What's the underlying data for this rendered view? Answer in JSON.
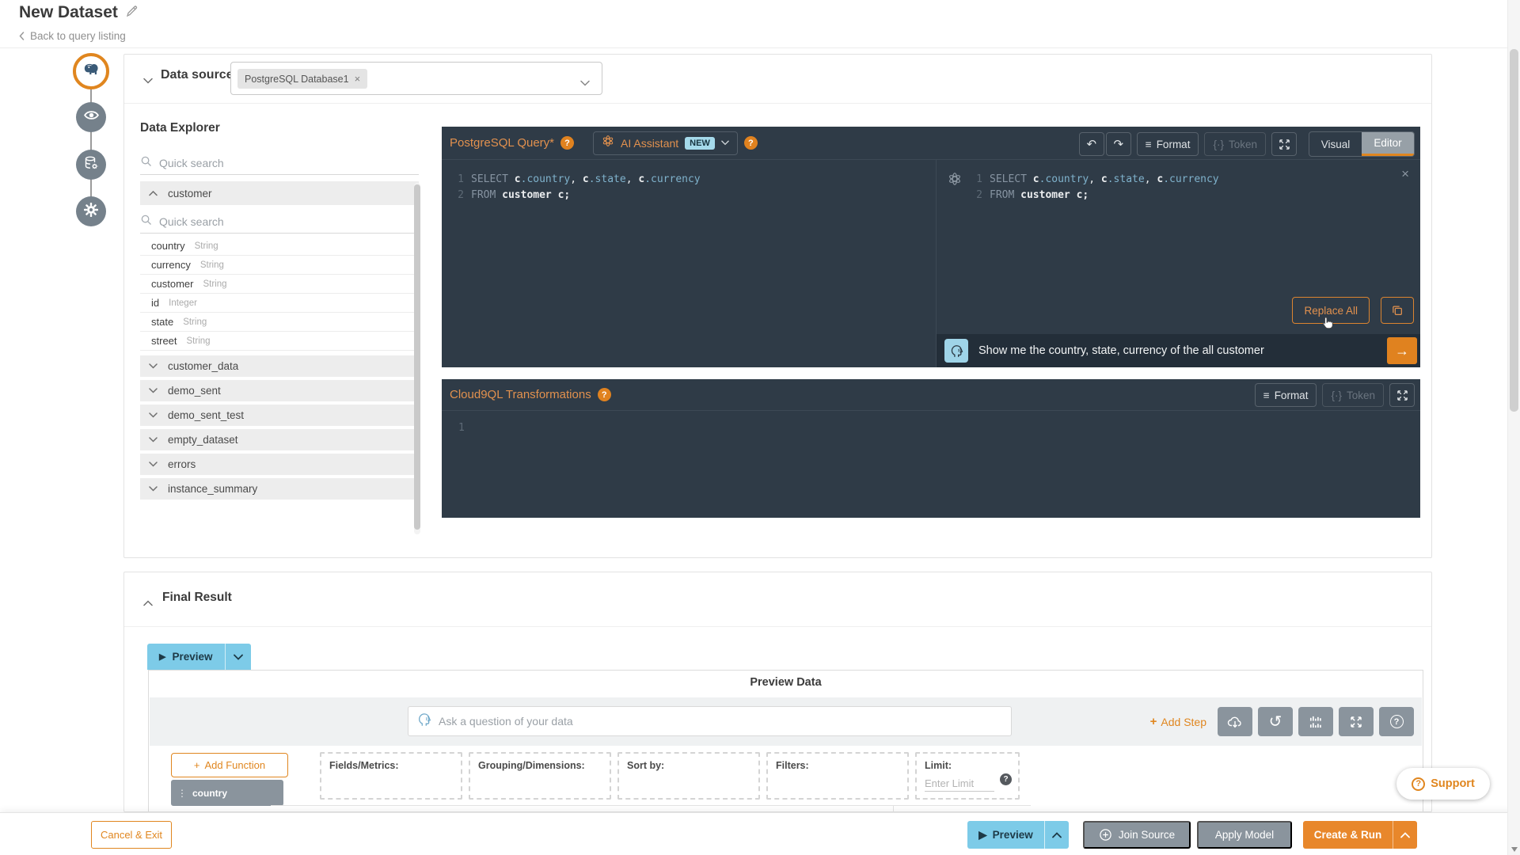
{
  "icons": {
    "play": "▶",
    "times": "×",
    "close": "×",
    "arrow_right": "→",
    "format_bars": "≡",
    "undo": "↶",
    "redo": "↷",
    "reset": "↺",
    "drag_dots": "⋮",
    "question": "?",
    "plus": "+",
    "token_braces": "{·}"
  },
  "colors": {
    "accent_orange": "#E0861F",
    "light_blue": "#7DCBE8",
    "panel_dark": "#2F3B47",
    "gray_button": "#8A949D"
  },
  "header": {
    "title": "New Dataset",
    "back_label": "Back to query listing"
  },
  "data_source": {
    "label": "Data source",
    "tag": "PostgreSQL Database1"
  },
  "explorer": {
    "title": "Data Explorer",
    "search_placeholder": "Quick search",
    "expanded_table": "customer",
    "field_search_placeholder": "Quick search",
    "fields": [
      {
        "name": "country",
        "type": "String"
      },
      {
        "name": "currency",
        "type": "String"
      },
      {
        "name": "customer",
        "type": "String"
      },
      {
        "name": "id",
        "type": "Integer"
      },
      {
        "name": "state",
        "type": "String"
      },
      {
        "name": "street",
        "type": "String"
      }
    ],
    "tables": [
      "customer_data",
      "demo_sent",
      "demo_sent_test",
      "empty_dataset",
      "errors",
      "instance_summary"
    ]
  },
  "query_editor": {
    "title": "PostgreSQL Query*",
    "ai_assistant": {
      "label": "AI Assistant",
      "badge": "NEW"
    },
    "toolbar": {
      "format": "Format",
      "token": "Token",
      "visual": "Visual",
      "editor": "Editor"
    },
    "code": [
      {
        "num": "1",
        "tokens": [
          [
            "kw",
            "SELECT "
          ],
          [
            "id",
            "c"
          ],
          [
            "pr",
            ".country"
          ],
          [
            "pu",
            ", "
          ],
          [
            "id",
            "c"
          ],
          [
            "pr",
            ".state"
          ],
          [
            "pu",
            ", "
          ],
          [
            "id",
            "c"
          ],
          [
            "pr",
            ".currency"
          ]
        ]
      },
      {
        "num": "2",
        "tokens": [
          [
            "kw",
            "FROM "
          ],
          [
            "id",
            "customer c;"
          ]
        ]
      }
    ],
    "ai_panel": {
      "replace_all": "Replace All",
      "prompt": "Show me the country, state, currency of the all customer"
    }
  },
  "cloud9ql": {
    "title": "Cloud9QL Transformations",
    "toolbar": {
      "format": "Format",
      "token": "Token"
    },
    "line_num": "1"
  },
  "final_result": {
    "title": "Final Result",
    "preview_button": "Preview",
    "panel_title": "Preview Data",
    "ask_placeholder": "Ask a question of your data",
    "add_step": "Add Step",
    "add_function": "Add Function",
    "chips": [
      "country"
    ],
    "dropzones": [
      "Fields/Metrics:",
      "Grouping/Dimensions:",
      "Sort by:",
      "Filters:"
    ],
    "limit": {
      "label": "Limit:",
      "placeholder": "Enter Limit"
    }
  },
  "footer": {
    "cancel": "Cancel & Exit",
    "preview": "Preview",
    "join_source": "Join Source",
    "apply_model": "Apply Model",
    "create_run": "Create & Run"
  },
  "support": {
    "label": "Support"
  }
}
